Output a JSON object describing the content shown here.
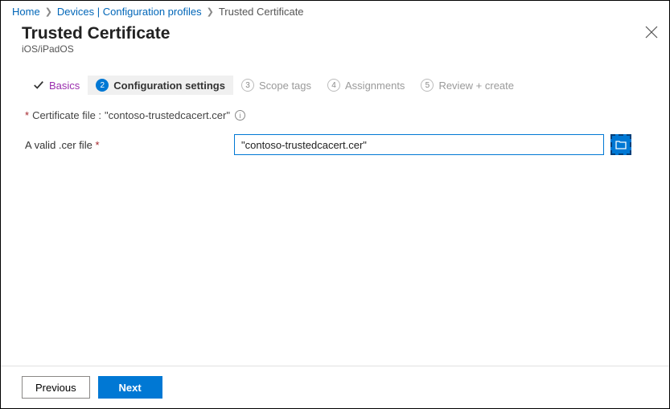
{
  "breadcrumb": {
    "items": [
      {
        "label": "Home"
      },
      {
        "label": "Devices | Configuration profiles"
      },
      {
        "label": "Trusted Certificate"
      }
    ]
  },
  "header": {
    "title": "Trusted Certificate",
    "subtitle": "iOS/iPadOS"
  },
  "wizard": {
    "steps": [
      {
        "label": "Basics"
      },
      {
        "num": "2",
        "label": "Configuration settings"
      },
      {
        "num": "3",
        "label": "Scope tags"
      },
      {
        "num": "4",
        "label": "Assignments"
      },
      {
        "num": "5",
        "label": "Review + create"
      }
    ]
  },
  "form": {
    "cert_label_prefix": "Certificate file : ",
    "cert_filename": "\"contoso-trustedcacert.cer\"",
    "valid_file_label": "A valid .cer file",
    "file_input_value": "\"contoso-trustedcacert.cer\""
  },
  "footer": {
    "previous": "Previous",
    "next": "Next"
  }
}
